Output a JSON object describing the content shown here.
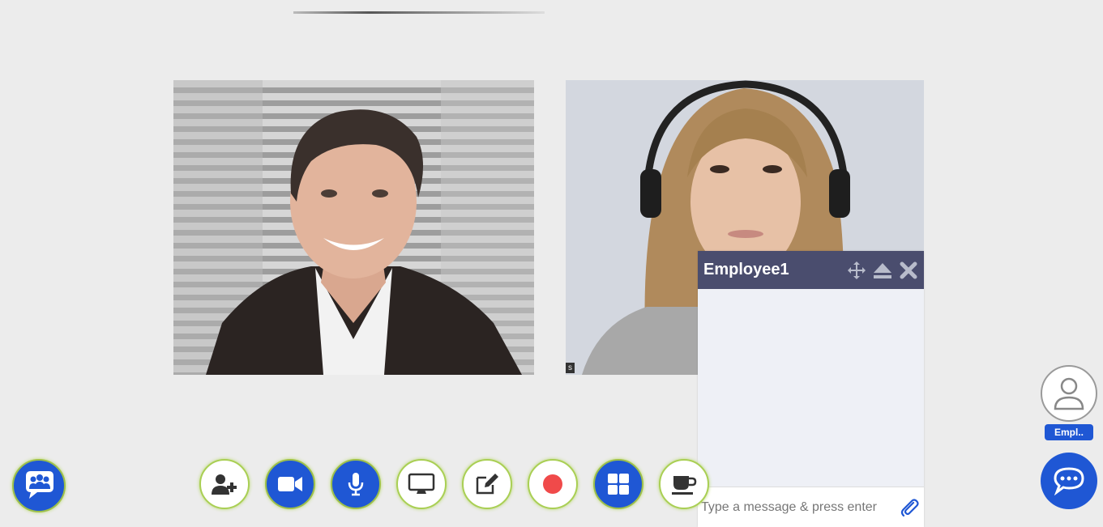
{
  "participants": [
    {
      "tile_tag": ""
    },
    {
      "tile_tag": "s"
    }
  ],
  "chat_window": {
    "title": "Employee1",
    "input_placeholder": "Type a message & press enter"
  },
  "sidebar": {
    "participant_name": "Empl.."
  },
  "toolbar": {
    "buttons": [
      "add-participant",
      "video",
      "microphone",
      "screen-share",
      "whiteboard",
      "record",
      "layout",
      "break"
    ]
  },
  "colors": {
    "primary_blue": "#1f57d4",
    "button_ring": "#a9cf54",
    "record_red": "#f04a4a",
    "chat_header": "#4a4d6e",
    "chat_body": "#eef0f6",
    "background": "#ececec"
  }
}
